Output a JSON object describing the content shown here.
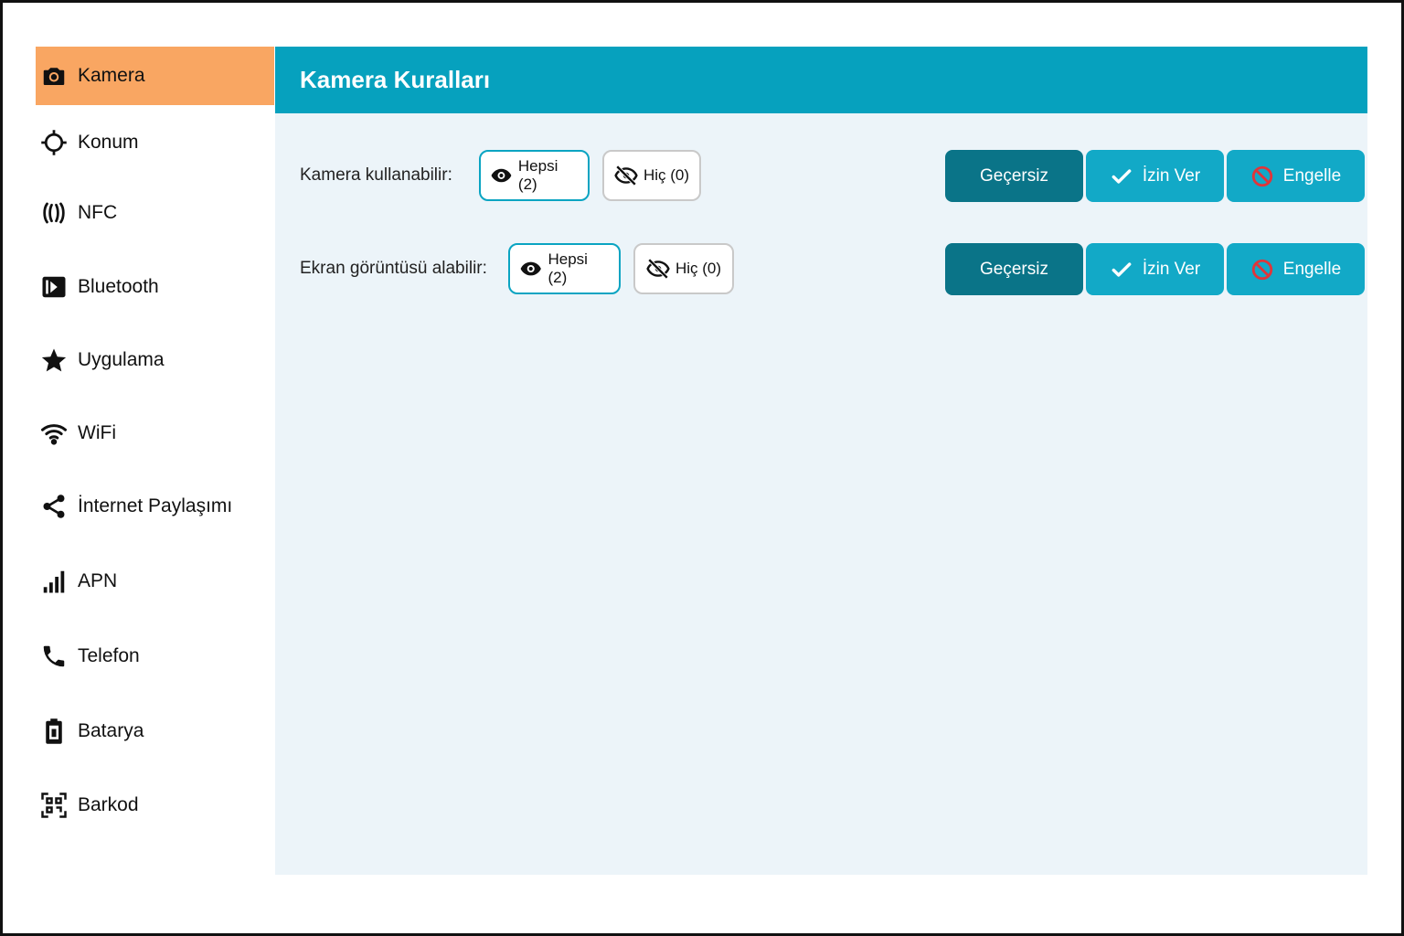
{
  "sidebar": {
    "items": [
      {
        "label": "Kamera",
        "icon": "camera-icon",
        "active": true
      },
      {
        "label": "Konum",
        "icon": "location-crosshair-icon"
      },
      {
        "label": "NFC",
        "icon": "nfc-icon"
      },
      {
        "label": "Bluetooth",
        "icon": "bluetooth-icon"
      },
      {
        "label": "Uygulama",
        "icon": "star-icon"
      },
      {
        "label": "WiFi",
        "icon": "wifi-icon"
      },
      {
        "label": "İnternet Paylaşımı",
        "icon": "share-icon"
      },
      {
        "label": "APN",
        "icon": "signal-bars-icon"
      },
      {
        "label": "Telefon",
        "icon": "phone-icon"
      },
      {
        "label": "Batarya",
        "icon": "battery-icon"
      },
      {
        "label": "Barkod",
        "icon": "qr-code-icon"
      }
    ]
  },
  "header": {
    "title": "Kamera Kuralları"
  },
  "rules": [
    {
      "label": "Kamera kullanabilir:",
      "all_label": "Hepsi (2)",
      "none_label": "Hiç (0)",
      "actions": {
        "invalid": "Geçersiz",
        "allow": "İzin Ver",
        "block": "Engelle"
      }
    },
    {
      "label": "Ekran görüntüsü alabilir:",
      "all_label": "Hepsi (2)",
      "none_label": "Hiç (0)",
      "actions": {
        "invalid": "Geçersiz",
        "allow": "İzin Ver",
        "block": "Engelle"
      }
    }
  ],
  "colors": {
    "active_item": "#f9a662",
    "header": "#06a1be",
    "invalid_button": "#0a7488",
    "action_button": "#12a9c7",
    "block_icon": "#e0353a"
  }
}
